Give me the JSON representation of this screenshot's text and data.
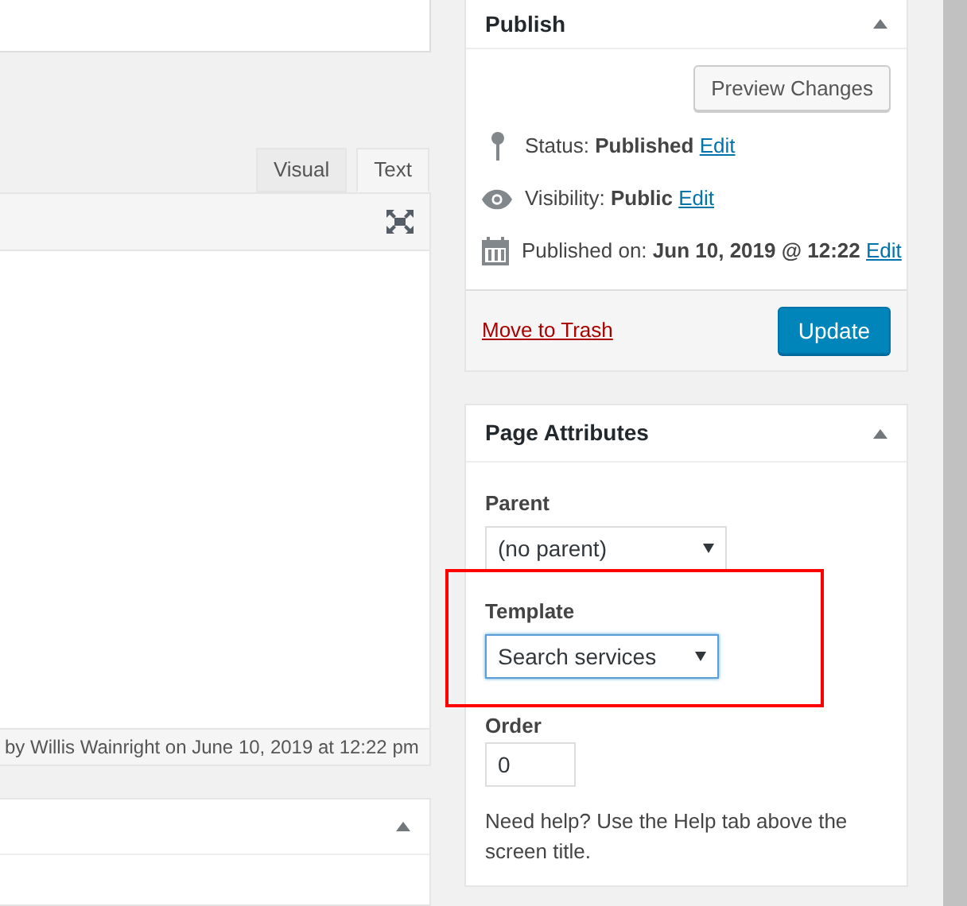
{
  "editor": {
    "tabs": [
      {
        "label": "Visual",
        "selected": false
      },
      {
        "label": "Text",
        "selected": true
      }
    ],
    "status_text": "by Willis Wainright on June 10, 2019 at 12:22 pm"
  },
  "publish": {
    "title": "Publish",
    "preview_button": "Preview Changes",
    "rows": [
      {
        "kind": "pin",
        "label": "Status:",
        "value": "Published",
        "link": "Edit"
      },
      {
        "kind": "eye",
        "label": "Visibility:",
        "value": "Public",
        "link": "Edit"
      },
      {
        "kind": "calendar",
        "label": "Published on:",
        "value": "Jun 10, 2019 @ 12:22",
        "link": "Edit"
      }
    ],
    "trash_link": "Move to Trash",
    "update_button": "Update"
  },
  "page_attributes": {
    "title": "Page Attributes",
    "parent_label": "Parent",
    "parent_value": "(no parent)",
    "template_label": "Template",
    "template_value": "Search services",
    "order_label": "Order",
    "order_value": "0",
    "help_text": "Need help? Use the Help tab above the screen title."
  }
}
